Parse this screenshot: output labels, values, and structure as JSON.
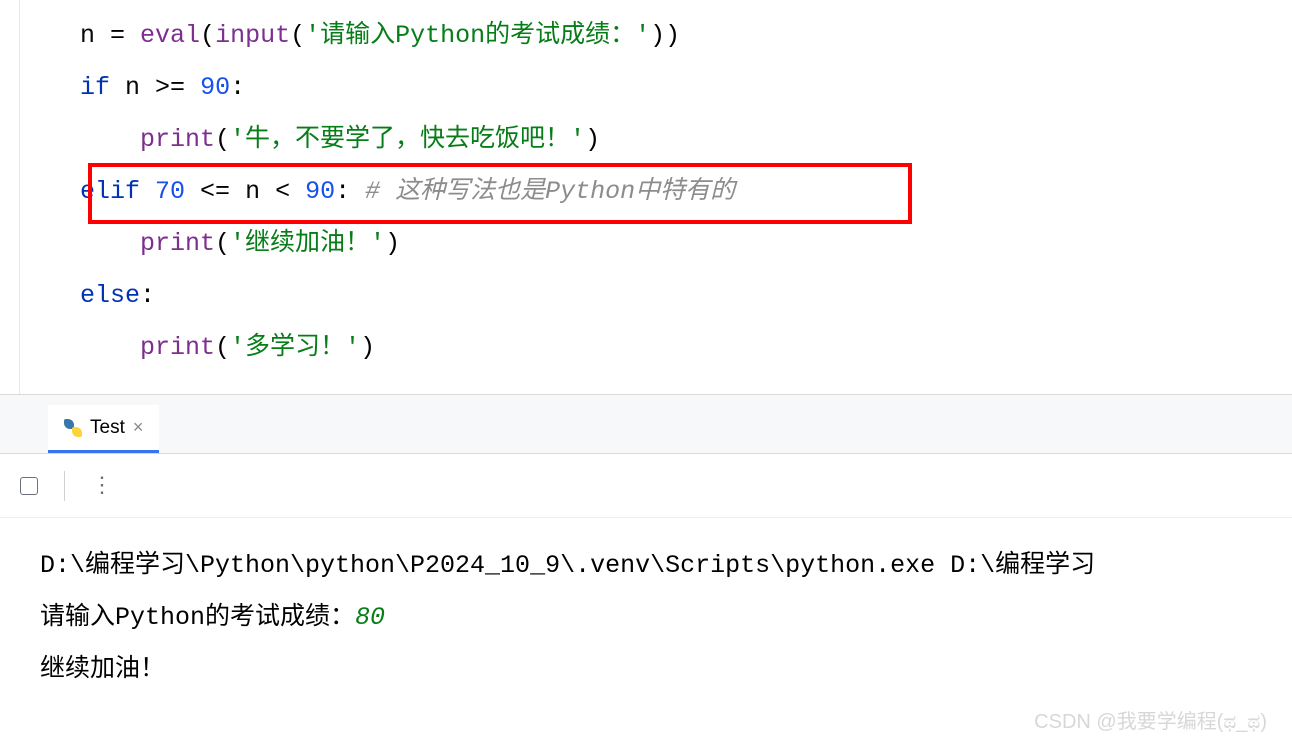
{
  "code": {
    "line1": {
      "var": "n",
      "assign": " = ",
      "eval": "eval",
      "lparen1": "(",
      "input": "input",
      "lparen2": "(",
      "str": "'请输入Python的考试成绩：'",
      "rparen": "))"
    },
    "line2": {
      "kw": "if",
      "sp": " ",
      "var": "n",
      "op": " >= ",
      "num": "90",
      "colon": ":"
    },
    "line3": {
      "indent": "    ",
      "print": "print",
      "lparen": "(",
      "str": "'牛，不要学了，快去吃饭吧！'",
      "rparen": ")"
    },
    "line4": {
      "kw": "elif",
      "sp": " ",
      "num1": "70",
      "op1": " <= ",
      "var": "n",
      "op2": " < ",
      "num2": "90",
      "colon": ":",
      "sp2": " ",
      "cmt": "# 这种写法也是Python中特有的"
    },
    "line5": {
      "indent": "    ",
      "print": "print",
      "lparen": "(",
      "str": "'继续加油！'",
      "rparen": ")"
    },
    "line6": {
      "kw": "else",
      "colon": ":"
    },
    "line7": {
      "indent": "    ",
      "print": "print",
      "lparen": "(",
      "str": "'多学习！'",
      "rparen": ")"
    }
  },
  "tab": {
    "label": "Test",
    "close": "×"
  },
  "console": {
    "path": "D:\\编程学习\\Python\\python\\P2024_10_9\\.venv\\Scripts\\python.exe D:\\编程学习",
    "prompt": "请输入Python的考试成绩：",
    "input_value": "80",
    "output": "继续加油！"
  },
  "watermark": "CSDN @我要学编程(ಥ_ಥ)"
}
